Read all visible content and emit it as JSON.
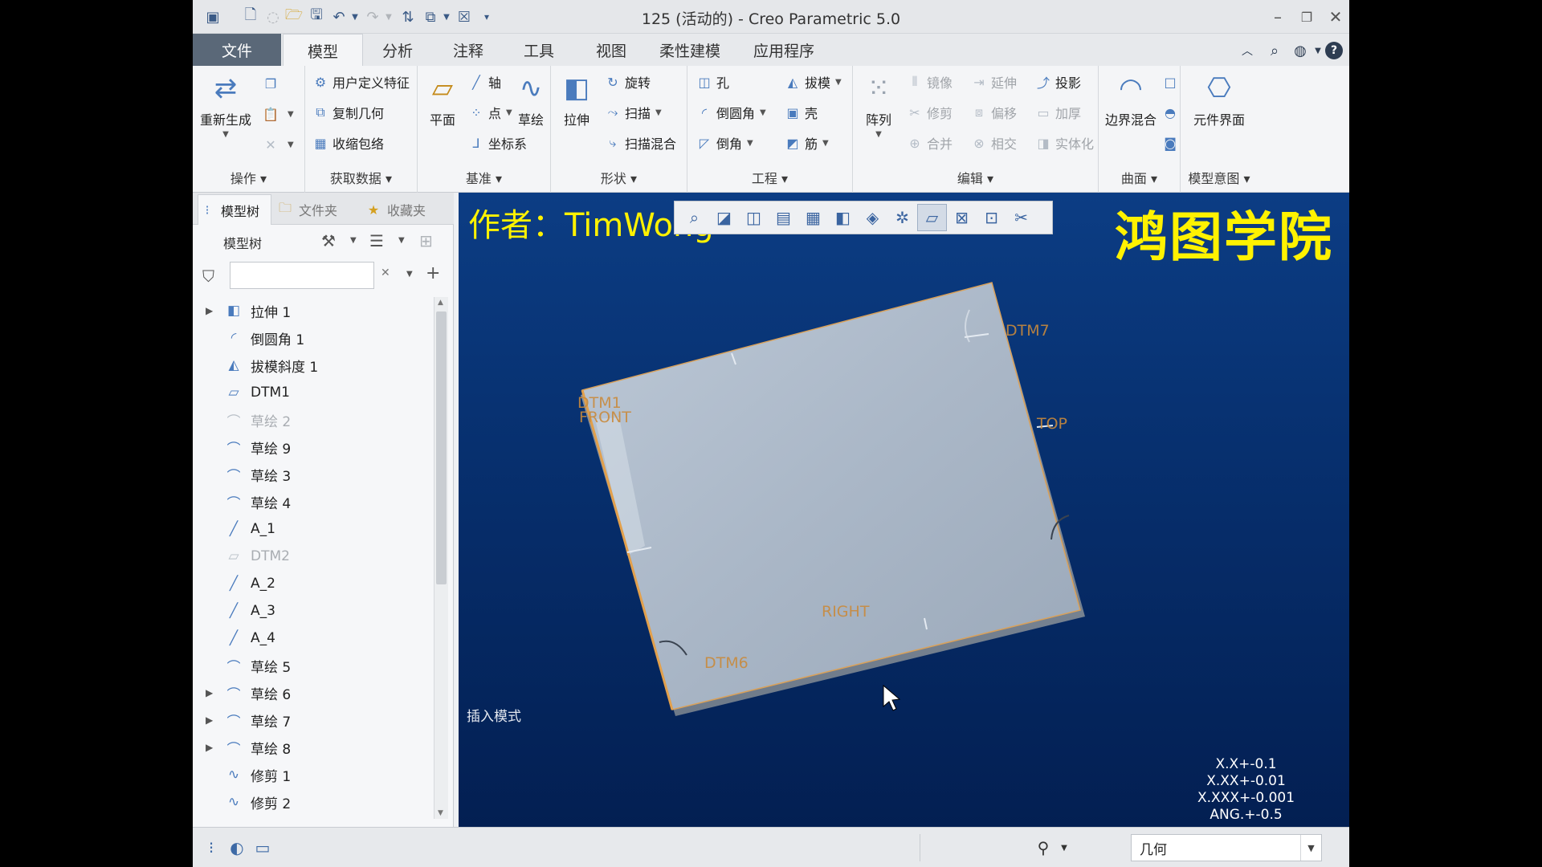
{
  "window": {
    "title": "125 (活动的) - Creo Parametric 5.0"
  },
  "menubar": {
    "tabs": [
      "文件",
      "模型",
      "分析",
      "注释",
      "工具",
      "视图",
      "柔性建模",
      "应用程序"
    ],
    "active_tab": "模型"
  },
  "ribbon": {
    "operations": {
      "label": "操作",
      "regenerate": "重新生成"
    },
    "get_data": {
      "label": "获取数据",
      "items": [
        "用户定义特征",
        "复制几何",
        "收缩包络"
      ]
    },
    "datum": {
      "label": "基准",
      "plane": "平面",
      "axis": "轴",
      "point": "点",
      "csys": "坐标系",
      "sketch": "草绘"
    },
    "shapes": {
      "label": "形状",
      "extrude": "拉伸",
      "revolve": "旋转",
      "sweep": "扫描",
      "swept_blend": "扫描混合"
    },
    "engineering": {
      "label": "工程",
      "hole": "孔",
      "round": "倒圆角",
      "chamfer": "倒角",
      "draft": "拔模",
      "shell": "壳",
      "rib": "筋"
    },
    "editing": {
      "label": "编辑",
      "pattern": "阵列",
      "mirror": "镜像",
      "trim": "修剪",
      "merge": "合并",
      "extend": "延伸",
      "offset": "偏移",
      "intersect": "相交",
      "project": "投影",
      "thicken": "加厚",
      "solidify": "实体化"
    },
    "surfaces": {
      "label": "曲面",
      "boundary_blend": "边界混合"
    },
    "model_intent": {
      "label": "模型意图",
      "component_interface": "元件界面"
    }
  },
  "left_panel": {
    "tabs": [
      "模型树",
      "文件夹",
      "收藏夹"
    ],
    "tree_title": "模型树",
    "search_placeholder": "",
    "items": [
      {
        "label": "拉伸 1",
        "icon": "extrude-icon",
        "expandable": true,
        "dim": false
      },
      {
        "label": "倒圆角 1",
        "icon": "round-icon",
        "expandable": false,
        "dim": false
      },
      {
        "label": "拔模斜度 1",
        "icon": "draft-icon",
        "expandable": false,
        "dim": false
      },
      {
        "label": "DTM1",
        "icon": "datum-plane-icon",
        "expandable": false,
        "dim": false
      },
      {
        "label": "草绘 2",
        "icon": "sketch-icon",
        "expandable": false,
        "dim": true
      },
      {
        "label": "草绘 9",
        "icon": "sketch-icon",
        "expandable": false,
        "dim": false
      },
      {
        "label": "草绘 3",
        "icon": "sketch-icon",
        "expandable": false,
        "dim": false
      },
      {
        "label": "草绘 4",
        "icon": "sketch-icon",
        "expandable": false,
        "dim": false
      },
      {
        "label": "A_1",
        "icon": "datum-axis-icon",
        "expandable": false,
        "dim": false
      },
      {
        "label": "DTM2",
        "icon": "datum-plane-icon",
        "expandable": false,
        "dim": true
      },
      {
        "label": "A_2",
        "icon": "datum-axis-icon",
        "expandable": false,
        "dim": false
      },
      {
        "label": "A_3",
        "icon": "datum-axis-icon",
        "expandable": false,
        "dim": false
      },
      {
        "label": "A_4",
        "icon": "datum-axis-icon",
        "expandable": false,
        "dim": false
      },
      {
        "label": "草绘 5",
        "icon": "sketch-icon",
        "expandable": false,
        "dim": false
      },
      {
        "label": "草绘 6",
        "icon": "sketch-icon",
        "expandable": true,
        "dim": false
      },
      {
        "label": "草绘 7",
        "icon": "sketch-icon",
        "expandable": true,
        "dim": false
      },
      {
        "label": "草绘 8",
        "icon": "sketch-icon",
        "expandable": true,
        "dim": false
      },
      {
        "label": "修剪 1",
        "icon": "trim-icon",
        "expandable": false,
        "dim": false
      },
      {
        "label": "修剪 2",
        "icon": "trim-icon",
        "expandable": false,
        "dim": false
      }
    ]
  },
  "viewport": {
    "author_text": "作者：TimWong",
    "logo_text": "鸿图学院",
    "mode_text": "插入模式",
    "datum_labels": {
      "dtm7": "DTM7",
      "dtm1": "DTM1",
      "front": "FRONT",
      "top": "TOP",
      "right": "RIGHT",
      "dtm6": "DTM6"
    },
    "tolerances": [
      "X.X+-0.1",
      "X.XX+-0.01",
      "X.XXX+-0.001",
      "ANG.+-0.5"
    ],
    "background_top": "#0c3d84",
    "background_bottom": "#031f52",
    "label_color": "#ff8c2a",
    "overlay_color": "#fff200"
  },
  "status_bar": {
    "selection_filter": "几何"
  }
}
